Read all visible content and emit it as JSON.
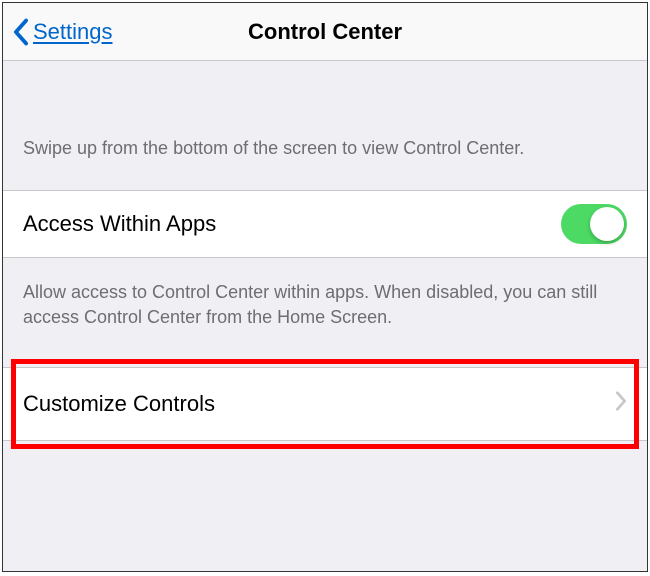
{
  "nav": {
    "back_label": "Settings",
    "title": "Control Center"
  },
  "section1": {
    "description": "Swipe up from the bottom of the screen to view Control Center."
  },
  "toggle_row": {
    "label": "Access Within Apps",
    "enabled": true
  },
  "section2": {
    "description": "Allow access to Control Center within apps. When disabled, you can still access Control Center from the Home Screen."
  },
  "customize_row": {
    "label": "Customize Controls",
    "highlighted": true
  },
  "colors": {
    "link": "#0066cc",
    "toggle_on": "#4cd964",
    "highlight": "#ff0000"
  }
}
